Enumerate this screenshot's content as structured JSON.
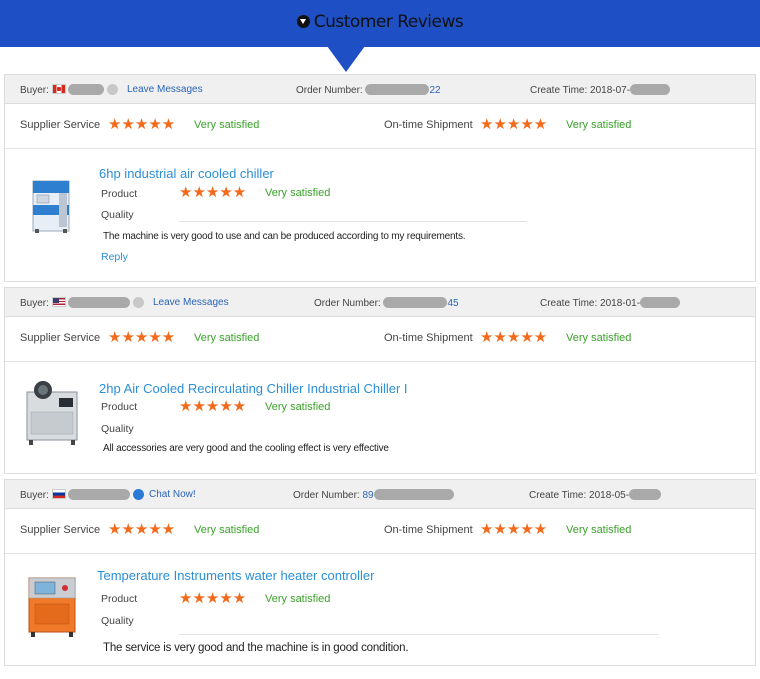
{
  "banner": {
    "title": "Customer Reviews",
    "icon": "chevron-down-circle-icon"
  },
  "labels": {
    "buyer": "Buyer:",
    "order_number": "Order Number:",
    "create_time": "Create Time:",
    "supplier_service": "Supplier Service",
    "ontime_shipment": "On-time Shipment",
    "product": "Product",
    "quality": "Quality",
    "very_satisfied": "Very satisfied",
    "stars": "★★★★★"
  },
  "reviews": [
    {
      "flag": "canada",
      "action": "Leave Messages",
      "order_suffix": "22",
      "create_time": "2018-07-",
      "product_title": "6hp industrial air cooled chiller",
      "comment": "The machine is very good to use and can be produced according to my requirements.",
      "reply": "Reply"
    },
    {
      "flag": "usa",
      "action": "Leave Messages",
      "order_suffix": "45",
      "create_time": "2018-01-",
      "product_title": "2hp Air Cooled Recirculating Chiller Industrial Chiller I",
      "comment": "All accessories are very good and the cooling effect is very effective"
    },
    {
      "flag": "russia",
      "action": "Chat Now!",
      "order_prefix": "89",
      "create_time": "2018-05-",
      "product_title": "Temperature Instruments water heater controller",
      "comment": "The service is very good and the machine is in good condition."
    }
  ],
  "colors": {
    "banner": "#1e4fc4",
    "stars": "#f26a1b",
    "satisfied": "#3aa329",
    "link": "#2a8fd6"
  }
}
